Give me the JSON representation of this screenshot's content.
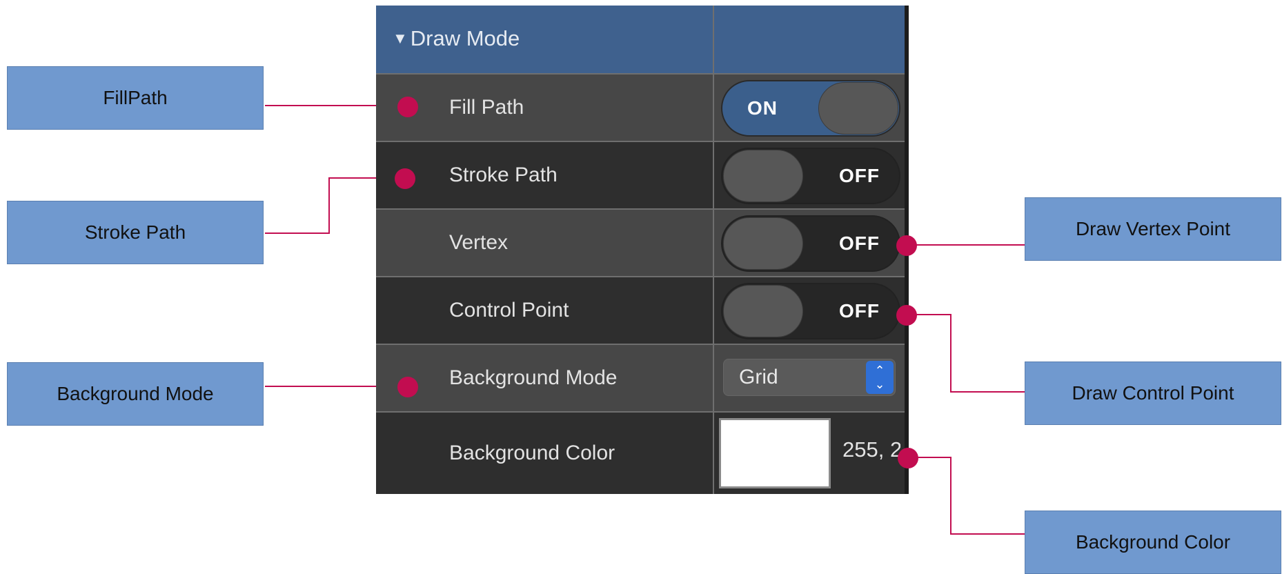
{
  "accent_colors": {
    "header": "#3f618e",
    "toggle_on": "#3b5f8c",
    "select_stepper": "#2f6fd6",
    "marker": "#c20d50",
    "callout": "#7099cf"
  },
  "panel": {
    "header": {
      "title": "Draw Mode",
      "expand_icon": "disclosure-triangle-down",
      "glyph": "▼"
    },
    "rows": {
      "fill_path": {
        "label": "Fill Path",
        "toggle": "ON"
      },
      "stroke_path": {
        "label": "Stroke Path",
        "toggle": "OFF"
      },
      "vertex": {
        "label": "Vertex",
        "toggle": "OFF"
      },
      "control_point": {
        "label": "Control Point",
        "toggle": "OFF"
      },
      "background_mode": {
        "label": "Background Mode",
        "value": "Grid",
        "stepper_up": "⌃",
        "stepper_down": "⌄"
      },
      "background_color": {
        "label": "Background Color",
        "swatch": "#ffffff",
        "value_text": "255, 2"
      }
    }
  },
  "callouts": {
    "fill_path": "FillPath",
    "stroke_path": "Stroke Path",
    "background_mode": "Background Mode",
    "draw_vertex_point": "Draw Vertex Point",
    "draw_control_point": "Draw Control Point",
    "background_color": "Background Color"
  }
}
